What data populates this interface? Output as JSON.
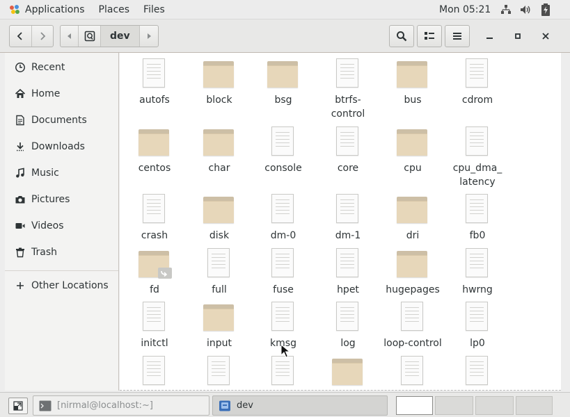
{
  "topbar": {
    "applications": "Applications",
    "places": "Places",
    "files": "Files",
    "clock": "Mon 05:21",
    "tray": [
      "network-icon",
      "volume-icon",
      "battery-icon"
    ]
  },
  "header": {
    "current_folder": "dev",
    "buttons": [
      "back",
      "forward",
      "path-left",
      "root",
      "path-right",
      "search",
      "list-view",
      "menu",
      "minimize",
      "maximize",
      "close"
    ]
  },
  "sidebar": {
    "items": [
      {
        "label": "Recent",
        "icon": "clock-icon"
      },
      {
        "label": "Home",
        "icon": "home-icon"
      },
      {
        "label": "Documents",
        "icon": "document-icon"
      },
      {
        "label": "Downloads",
        "icon": "download-icon"
      },
      {
        "label": "Music",
        "icon": "music-icon"
      },
      {
        "label": "Pictures",
        "icon": "camera-icon"
      },
      {
        "label": "Videos",
        "icon": "video-icon"
      },
      {
        "label": "Trash",
        "icon": "trash-icon"
      },
      {
        "label": "Other Locations",
        "icon": "plus-icon"
      }
    ]
  },
  "files": [
    {
      "name": "autofs",
      "type": "file"
    },
    {
      "name": "block",
      "type": "folder"
    },
    {
      "name": "bsg",
      "type": "folder"
    },
    {
      "name": "btrfs-\ncontrol",
      "type": "file"
    },
    {
      "name": "bus",
      "type": "folder"
    },
    {
      "name": "cdrom",
      "type": "file"
    },
    {
      "name": "centos",
      "type": "folder"
    },
    {
      "name": "char",
      "type": "folder"
    },
    {
      "name": "console",
      "type": "file"
    },
    {
      "name": "core",
      "type": "file"
    },
    {
      "name": "cpu",
      "type": "folder"
    },
    {
      "name": "cpu_dma_\nlatency",
      "type": "file"
    },
    {
      "name": "crash",
      "type": "file"
    },
    {
      "name": "disk",
      "type": "folder"
    },
    {
      "name": "dm-0",
      "type": "file"
    },
    {
      "name": "dm-1",
      "type": "file"
    },
    {
      "name": "dri",
      "type": "folder"
    },
    {
      "name": "fb0",
      "type": "file"
    },
    {
      "name": "fd",
      "type": "folder-link"
    },
    {
      "name": "full",
      "type": "file"
    },
    {
      "name": "fuse",
      "type": "file"
    },
    {
      "name": "hpet",
      "type": "file"
    },
    {
      "name": "hugepages",
      "type": "folder"
    },
    {
      "name": "hwrng",
      "type": "file"
    },
    {
      "name": "initctl",
      "type": "file"
    },
    {
      "name": "input",
      "type": "folder"
    },
    {
      "name": "kmsg",
      "type": "file"
    },
    {
      "name": "log",
      "type": "file"
    },
    {
      "name": "loop-control",
      "type": "file"
    },
    {
      "name": "lp0",
      "type": "file"
    },
    {
      "name": "",
      "type": "file"
    },
    {
      "name": "",
      "type": "file"
    },
    {
      "name": "",
      "type": "file"
    },
    {
      "name": "",
      "type": "folder"
    },
    {
      "name": "",
      "type": "file"
    },
    {
      "name": "",
      "type": "file"
    }
  ],
  "taskbar": {
    "terminal": "[nirmal@localhost:~]",
    "files_window": "dev",
    "workspaces": 4
  },
  "colors": {
    "folder": "#e7d7ba",
    "folder_tab": "#cdbfa6",
    "accent": "#4a90d9"
  }
}
